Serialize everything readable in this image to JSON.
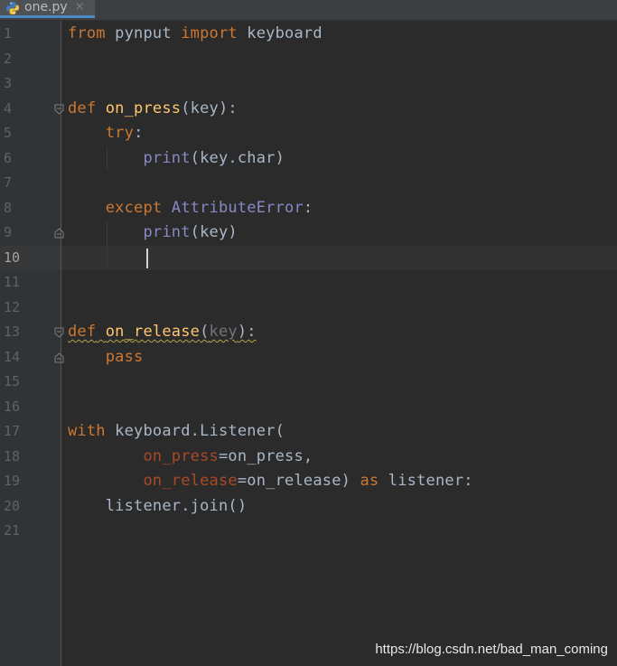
{
  "tab": {
    "filename": "one.py",
    "close_glyph": "×",
    "icon": "python-file-icon"
  },
  "editor": {
    "current_line": 10,
    "lines": [
      {
        "n": "1"
      },
      {
        "n": "2"
      },
      {
        "n": "3"
      },
      {
        "n": "4"
      },
      {
        "n": "5"
      },
      {
        "n": "6"
      },
      {
        "n": "7"
      },
      {
        "n": "8"
      },
      {
        "n": "9"
      },
      {
        "n": "10"
      },
      {
        "n": "11"
      },
      {
        "n": "12"
      },
      {
        "n": "13"
      },
      {
        "n": "14"
      },
      {
        "n": "15"
      },
      {
        "n": "16"
      },
      {
        "n": "17"
      },
      {
        "n": "18"
      },
      {
        "n": "19"
      },
      {
        "n": "20"
      },
      {
        "n": "21"
      }
    ],
    "tokens": {
      "from": "from",
      "pynput": " pynput ",
      "import": "import",
      "keyboard": " keyboard",
      "def": "def",
      "on_press": "on_press",
      "key": "key",
      "try": "try",
      "print": "print",
      "key_char": "(key.char)",
      "except": "except",
      "attribute_error": "AttributeError",
      "print_key": "(key)",
      "on_release": "on_release",
      "pass": "pass",
      "with": "with",
      "listener_call": " keyboard.Listener(",
      "on_press_kw": "on_press",
      "on_press_val": "=on_press,",
      "on_release_kw": "on_release",
      "on_release_val": "=on_release) ",
      "as": "as",
      "listener": " listener:",
      "join": "listener.join()"
    }
  },
  "watermark": "https://blog.csdn.net/bad_man_coming",
  "colors": {
    "background": "#2b2b2b",
    "keyword": "#cc7832",
    "function_name": "#ffc66d",
    "builtin": "#8888c6",
    "parameter_keyword": "#aa4926",
    "text": "#a9b7c6"
  }
}
